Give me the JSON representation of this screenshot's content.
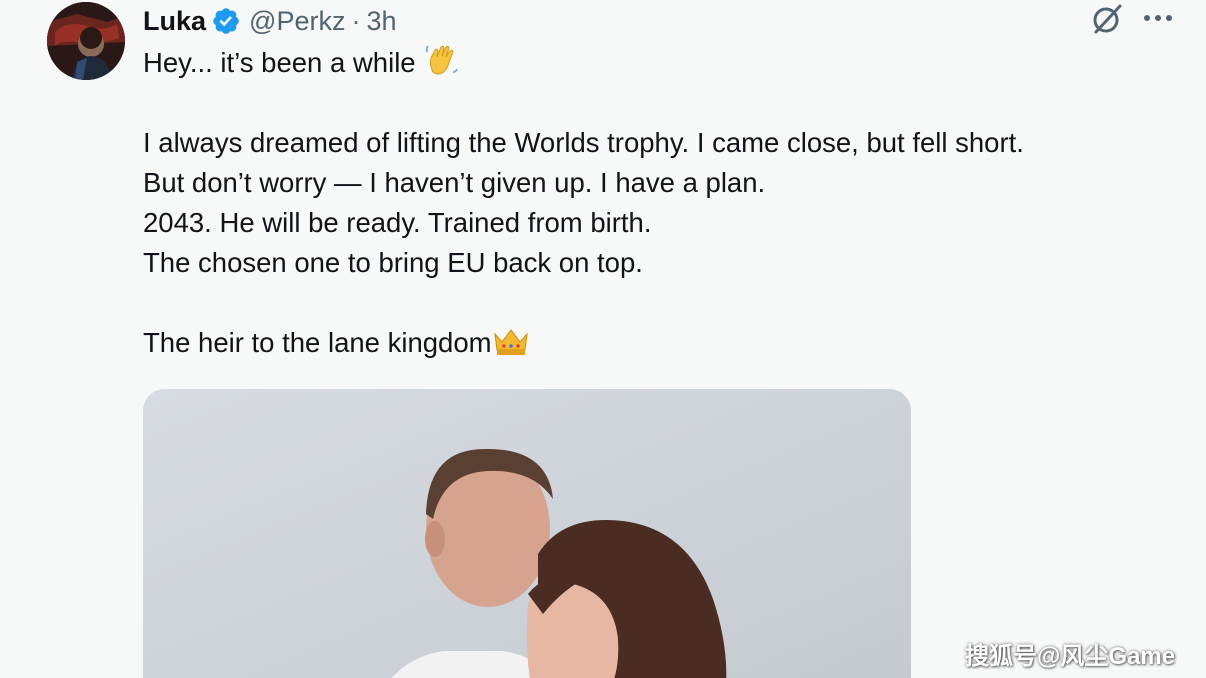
{
  "tweet": {
    "author_name": "Luka",
    "handle": "@Perkz",
    "separator": "·",
    "time": "3h",
    "lines": [
      "Hey... it’s been a while",
      "",
      "I always dreamed of lifting the Worlds trophy. I came close, but fell short.",
      "But don’t worry — I haven’t given up. I have a plan.",
      "2043. He will be ready. Trained from birth.",
      "The chosen one to bring EU back on top.",
      "",
      "The heir to the lane kingdom"
    ],
    "media_description_icon": "photo-couple"
  },
  "icons": {
    "verified": "verified-badge-icon",
    "grok": "grok-icon",
    "more": "more-options-icon",
    "wave": "waving-hand-emoji",
    "crown": "crown-emoji"
  },
  "colors": {
    "text_primary": "#0f1419",
    "text_secondary": "#536471",
    "verified_blue": "#1d9bf0",
    "background": "#f7f8f8"
  },
  "watermark": "搜狐号@风尘Game"
}
